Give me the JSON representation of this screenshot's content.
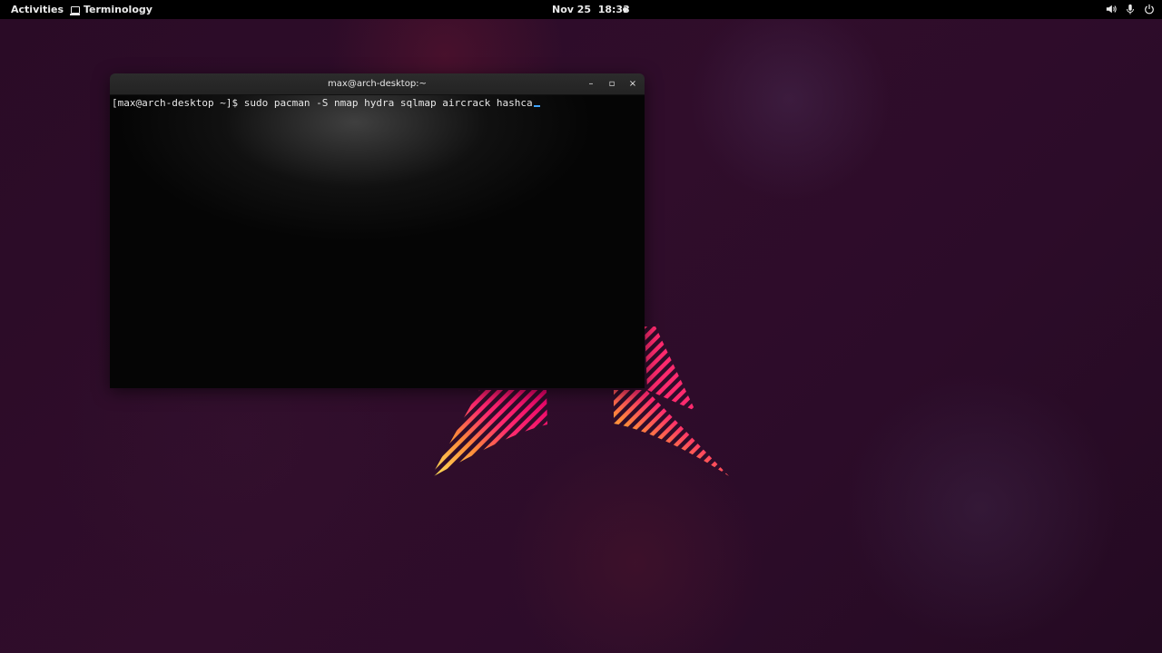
{
  "topbar": {
    "activities_label": "Activities",
    "app_name": "Terminology",
    "clock": "Nov 25  18:33",
    "tray_icons": [
      "volume-icon",
      "microphone-icon",
      "power-icon"
    ]
  },
  "window": {
    "title": "max@arch-desktop:~",
    "controls": {
      "minimize": "–",
      "maximize": "▫",
      "close": "×"
    }
  },
  "terminal": {
    "prompt": "[max@arch-desktop ~]$ ",
    "command": "sudo pacman -S nmap hydra sqlmap aircrack hashca"
  },
  "colors": {
    "cursor": "#3fa4ff",
    "logo_gradient": [
      "#ffe45a",
      "#ff8a3a",
      "#ff2a6e",
      "#e8006a"
    ]
  }
}
